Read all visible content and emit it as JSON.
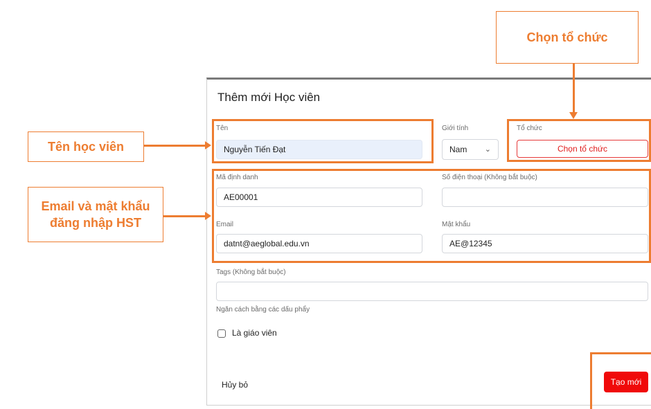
{
  "dialog": {
    "title": "Thêm mới Học viên",
    "fields": {
      "name": {
        "label": "Tên",
        "value": "Nguyễn Tiến Đạt"
      },
      "gender": {
        "label": "Giới tính",
        "value": "Nam"
      },
      "organization": {
        "label": "Tổ chức",
        "button": "Chọn tổ chức"
      },
      "student_id": {
        "label": "Mã định danh",
        "value": "AE00001"
      },
      "phone": {
        "label": "Số điện thoại (Không bắt buộc)",
        "value": ""
      },
      "email": {
        "label": "Email",
        "value": "datnt@aeglobal.edu.vn"
      },
      "password": {
        "label": "Mật khẩu",
        "value": "AE@12345"
      },
      "tags": {
        "label": "Tags (Không bắt buộc)",
        "value": "",
        "hint": "Ngăn cách bằng các dấu phẩy"
      },
      "is_teacher": {
        "label": "Là giáo viên",
        "checked": false
      }
    },
    "actions": {
      "cancel": "Hủy bỏ",
      "create": "Tạo mới"
    }
  },
  "annotations": {
    "org_callout": "Chọn tổ chức",
    "name_callout": "Tên học viên",
    "login_callout_line1": "Email và mật khẩu",
    "login_callout_line2": "đăng nhập HST"
  },
  "colors": {
    "annotation": "#ed7d31",
    "primary": "#f00a0a"
  }
}
